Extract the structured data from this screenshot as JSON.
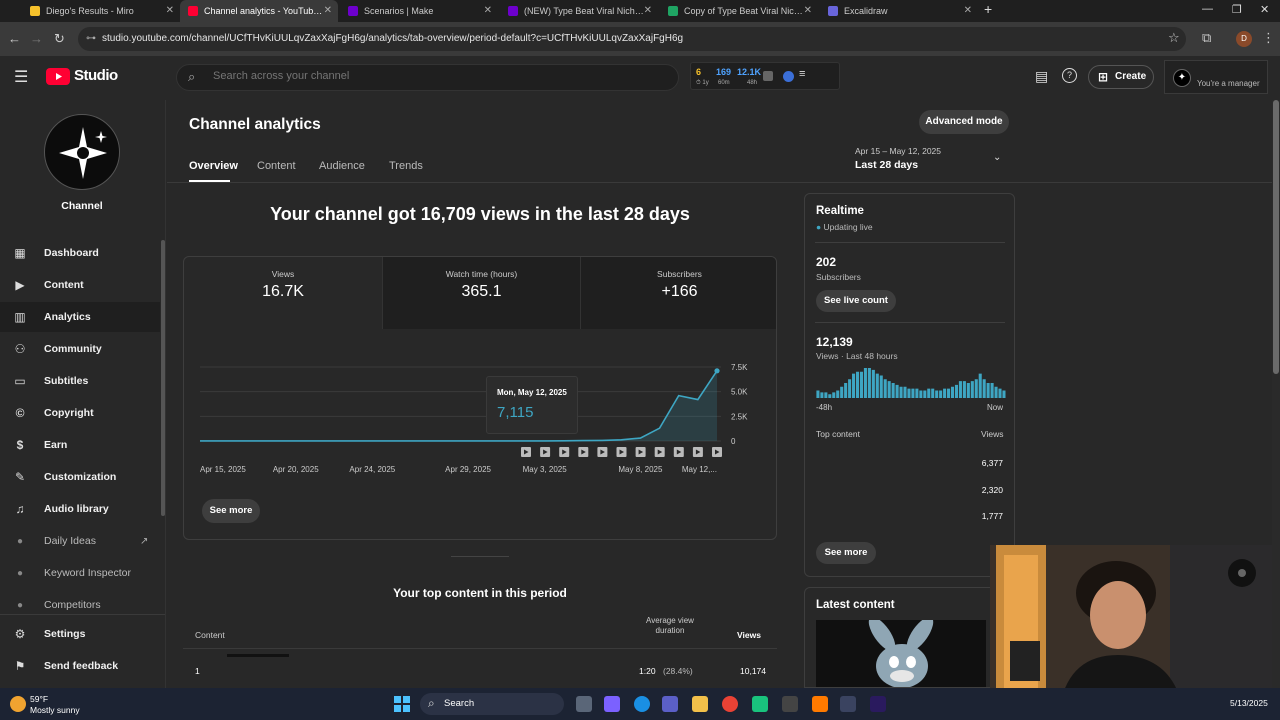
{
  "browser": {
    "tabs": [
      {
        "label": "Diego's Results - Miro",
        "color": "#f6c12b"
      },
      {
        "label": "Channel analytics - YouTube Studio",
        "color": "#ff0033"
      },
      {
        "label": "Scenarios | Make",
        "color": "#6d00cc"
      },
      {
        "label": "(NEW) Type Beat Viral Niche Sc",
        "color": "#6d00cc"
      },
      {
        "label": "Copy of Type Beat Viral Niche S",
        "color": "#1fa463"
      },
      {
        "label": "Excalidraw",
        "color": "#6965db"
      }
    ],
    "url": "studio.youtube.com/channel/UCfTHvKiUULqvZaxXajFgH6g/analytics/tab-overview/period-default?c=UCfTHvKiUULqvZaxXajFgH6g",
    "profile_initial": "D"
  },
  "header": {
    "logo_text": "Studio",
    "search_placeholder": "Search across your channel",
    "widget": {
      "a": "6",
      "a_sub": "1y",
      "b": "169",
      "b_sub": "60m",
      "c": "12.1K",
      "c_sub": "48h"
    },
    "create_label": "Create",
    "manager_label": "You're a manager"
  },
  "sidebar": {
    "channel_label": "Channel",
    "items": [
      {
        "label": "Dashboard",
        "icon": "grid-icon"
      },
      {
        "label": "Content",
        "icon": "play-icon"
      },
      {
        "label": "Analytics",
        "icon": "bar-icon"
      },
      {
        "label": "Community",
        "icon": "people-icon"
      },
      {
        "label": "Subtitles",
        "icon": "cc-icon"
      },
      {
        "label": "Copyright",
        "icon": "copyright-icon"
      },
      {
        "label": "Earn",
        "icon": "dollar-icon"
      },
      {
        "label": "Customization",
        "icon": "wand-icon"
      },
      {
        "label": "Audio library",
        "icon": "audio-icon"
      },
      {
        "label": "Daily Ideas",
        "icon": "ext-icon"
      },
      {
        "label": "Keyword Inspector",
        "icon": "ext-icon"
      },
      {
        "label": "Competitors",
        "icon": "ext-icon"
      }
    ],
    "settings_label": "Settings",
    "feedback_label": "Send feedback"
  },
  "main": {
    "title": "Channel analytics",
    "tabs": [
      "Overview",
      "Content",
      "Audience",
      "Trends"
    ],
    "advanced_mode": "Advanced mode",
    "date_range": "Apr 15 – May 12, 2025",
    "date_label": "Last 28 days",
    "headline": "Your channel got 16,709 views in the last 28 days",
    "metrics": [
      {
        "label": "Views",
        "value": "16.7K"
      },
      {
        "label": "Watch time (hours)",
        "value": "365.1"
      },
      {
        "label": "Subscribers",
        "value": "+166"
      }
    ],
    "tooltip": {
      "date": "Mon, May 12, 2025",
      "value": "7,115"
    },
    "see_more": "See more",
    "top_content_title": "Your top content in this period",
    "table": {
      "col_content": "Content",
      "col_avd": "Average view duration",
      "col_views": "Views",
      "rows": [
        {
          "rank": "1",
          "avd": "1:20",
          "avd_pct": "(28.4%)",
          "views": "10,174"
        }
      ]
    }
  },
  "chart_data": {
    "type": "area",
    "x": [
      "Apr 15, 2025",
      "Apr 16",
      "Apr 17",
      "Apr 18",
      "Apr 19",
      "Apr 20, 2025",
      "Apr 21",
      "Apr 22",
      "Apr 23",
      "Apr 24, 2025",
      "Apr 25",
      "Apr 26",
      "Apr 27",
      "Apr 28",
      "Apr 29, 2025",
      "Apr 30",
      "May 1",
      "May 2",
      "May 3, 2025",
      "May 4",
      "May 5",
      "May 6",
      "May 7",
      "May 8, 2025",
      "May 9",
      "May 10",
      "May 11",
      "May 12, 2025"
    ],
    "x_tick_labels": [
      "Apr 15, 2025",
      "Apr 20, 2025",
      "Apr 24, 2025",
      "Apr 29, 2025",
      "May 3, 2025",
      "May 8, 2025",
      "May 12,..."
    ],
    "series": [
      {
        "values": [
          10,
          10,
          10,
          10,
          10,
          10,
          10,
          10,
          10,
          10,
          10,
          10,
          10,
          10,
          10,
          10,
          10,
          10,
          10,
          20,
          40,
          60,
          120,
          300,
          1300,
          4600,
          4200,
          7115
        ]
      }
    ],
    "y_ticks": [
      "0",
      "2.5K",
      "5.0K",
      "7.5K"
    ],
    "ylim": [
      0,
      7500
    ],
    "color": "#3ea6c3"
  },
  "realtime": {
    "title": "Realtime",
    "status": "Updating live",
    "subs_value": "202",
    "subs_label": "Subscribers",
    "live_count_btn": "See live count",
    "views_value": "12,139",
    "views_label": "Views · Last 48 hours",
    "axis_left": "-48h",
    "axis_right": "Now",
    "hourly": [
      2,
      1.5,
      1.5,
      1,
      1.5,
      2,
      3,
      4,
      5,
      6.5,
      7,
      7,
      8,
      8,
      7.5,
      6.5,
      6,
      5,
      4.5,
      4,
      3.5,
      3,
      3,
      2.5,
      2.5,
      2.5,
      2,
      2,
      2.5,
      2.5,
      2,
      2,
      2.5,
      2.5,
      3,
      3.5,
      4.5,
      4.5,
      4,
      4.5,
      5,
      6.5,
      5,
      4,
      4,
      3,
      2.5,
      2
    ],
    "top_content_label": "Top content",
    "views_col": "Views",
    "top_values": [
      "6,377",
      "2,320",
      "1,777"
    ],
    "see_more": "See more"
  },
  "latest": {
    "title": "Latest content"
  },
  "taskbar": {
    "weather_temp": "59°F",
    "weather_desc": "Mostly sunny",
    "search_label": "Search",
    "date": "5/13/2025"
  }
}
